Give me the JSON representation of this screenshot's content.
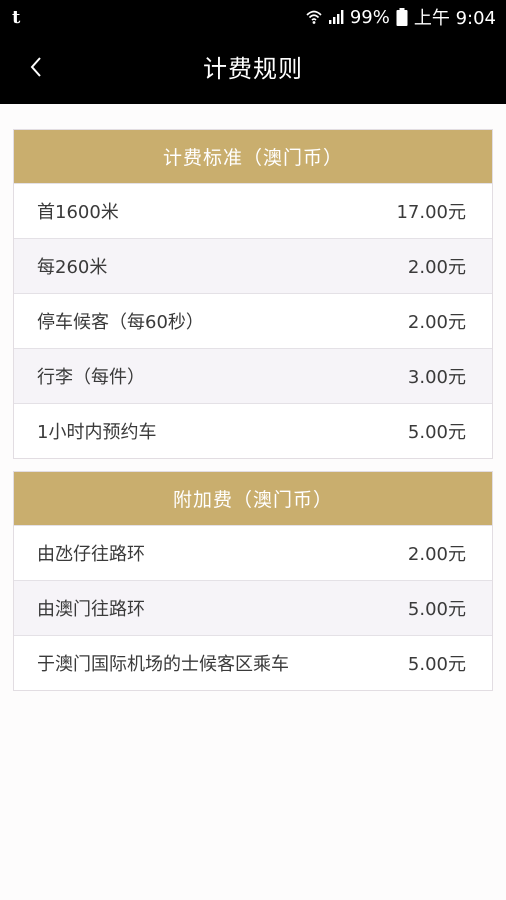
{
  "status_bar": {
    "app_icon": "t",
    "battery": "99%",
    "time": "上午 9:04",
    "icons": [
      "wifi-icon",
      "signal-icon",
      "battery-icon"
    ]
  },
  "nav": {
    "back_icon": "chevron-left-icon",
    "title": "计费规则"
  },
  "standard": {
    "header": "计费标准（澳门币）",
    "rows": [
      {
        "label": "首1600米",
        "price": "17.00元"
      },
      {
        "label": "每260米",
        "price": "2.00元"
      },
      {
        "label": "停车候客（每60秒）",
        "price": "2.00元"
      },
      {
        "label": "行李（每件）",
        "price": "3.00元"
      },
      {
        "label": "1小时内预约车",
        "price": "5.00元"
      }
    ]
  },
  "surcharge": {
    "header": "附加费（澳门币）",
    "rows": [
      {
        "label": "由氹仔往路环",
        "price": "2.00元"
      },
      {
        "label": "由澳门往路环",
        "price": "5.00元"
      },
      {
        "label": "于澳门国际机场的士候客区乘车",
        "price": "5.00元"
      }
    ]
  },
  "colors": {
    "header_gold": "#c9ae6e",
    "bar_black": "#000000",
    "alt_row": "#f6f4f8"
  }
}
